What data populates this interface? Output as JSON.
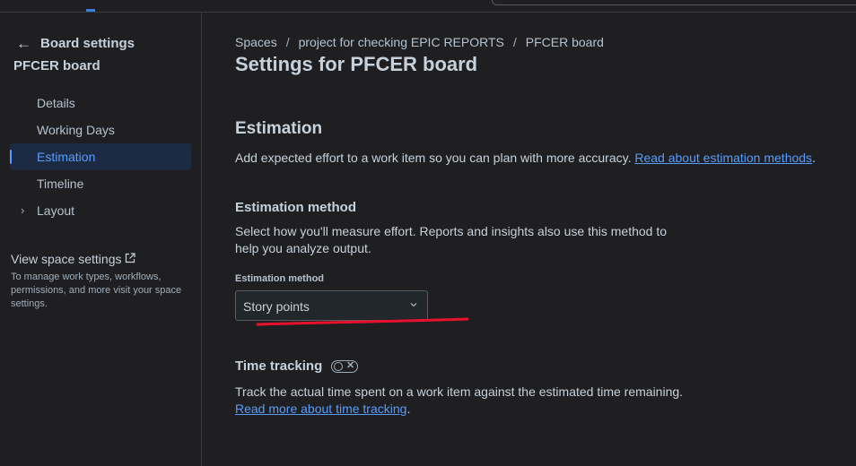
{
  "sidebar": {
    "back_title": "Board settings",
    "board_name": "PFCER board",
    "items": [
      {
        "label": "Details",
        "active": false
      },
      {
        "label": "Working Days",
        "active": false
      },
      {
        "label": "Estimation",
        "active": true
      },
      {
        "label": "Timeline",
        "active": false
      },
      {
        "label": "Layout",
        "active": false,
        "expandable": true
      }
    ],
    "view_space_label": "View space settings",
    "view_space_help": "To manage work types, workflows, permissions, and more visit your space settings."
  },
  "breadcrumb": [
    "Spaces",
    "project for checking EPIC REPORTS",
    "PFCER board"
  ],
  "page_title": "Settings for PFCER board",
  "estimation": {
    "title": "Estimation",
    "desc": "Add expected effort to a work item so you can plan with more accuracy.",
    "link": "Read about estimation methods",
    "method_heading": "Estimation method",
    "method_desc": "Select how you'll measure effort. Reports and insights also use this method to help you analyze output.",
    "field_label": "Estimation method",
    "selected_value": "Story points"
  },
  "time_tracking": {
    "title": "Time tracking",
    "toggle_on": false,
    "desc": "Track the actual time spent on a work item against the estimated time remaining.",
    "link": "Read more about time tracking"
  },
  "colors": {
    "background": "#1f1f21",
    "accent": "#579dff",
    "annotation": "#e8112d"
  }
}
